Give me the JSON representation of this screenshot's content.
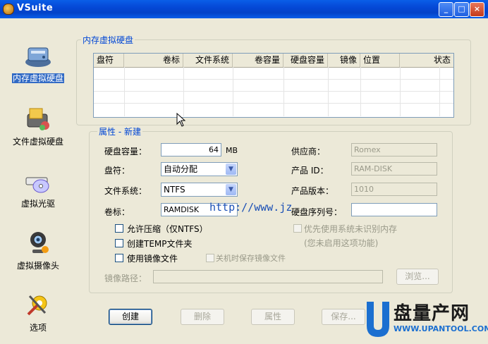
{
  "window": {
    "title": "VSuite",
    "controls": {
      "minimize": "_",
      "maximize": "□",
      "close": "×"
    }
  },
  "sidebar": {
    "items": [
      {
        "label": "内存虚拟硬盘",
        "icon": "ram-disk-icon",
        "active": true
      },
      {
        "label": "文件虚拟硬盘",
        "icon": "file-disk-icon",
        "active": false
      },
      {
        "label": "虚拟光驱",
        "icon": "virtual-cdrom-icon",
        "active": false
      },
      {
        "label": "虚拟摄像头",
        "icon": "webcam-icon",
        "active": false
      },
      {
        "label": "选项",
        "icon": "options-tools-icon",
        "active": false
      }
    ]
  },
  "disk_list": {
    "title": "内存虚拟硬盘",
    "columns": [
      "盘符",
      "卷标",
      "文件系统",
      "卷容量",
      "硬盘容量",
      "镜像",
      "位置",
      "状态"
    ],
    "rows": []
  },
  "properties": {
    "title": "属性 - 新建",
    "capacity_label": "硬盘容量：",
    "capacity_value": "64",
    "capacity_unit": "MB",
    "drive_label": "盘符：",
    "drive_value": "自动分配",
    "fs_label": "文件系统：",
    "fs_value": "NTFS",
    "volume_label": "卷标：",
    "volume_value": "RAMDISK",
    "vendor_label": "供应商：",
    "vendor_value": "Romex",
    "product_id_label": "产品 ID：",
    "product_id_value": "RAM-DISK",
    "product_version_label": "产品版本：",
    "product_version_value": "1010",
    "serial_label": "硬盘序列号：",
    "serial_value": "",
    "allow_compress_label": "允许压缩（仅NTFS）",
    "create_temp_label": "创建TEMP文件夹",
    "use_image_label": "使用镜像文件",
    "save_image_on_shutdown_label": "关机时保存镜像文件",
    "prefer_unrecognized_label": "优先使用系统未识别内存",
    "unavailable_note": "(您未启用这项功能)",
    "image_path_label": "镜像路径：",
    "image_path_value": "",
    "browse_label": "浏览..."
  },
  "actions": {
    "create": "创建",
    "delete": "删除",
    "properties": "属性",
    "save": "保存..."
  },
  "watermark": {
    "url": "http://www.jz"
  },
  "logo": {
    "main": "盘量产网",
    "sub": "WWW.UPANTOOL.COM"
  },
  "colors": {
    "titlebar": "#0548d6",
    "group_title": "#0046d5",
    "selection": "#316ac5",
    "face": "#ece9d8"
  }
}
